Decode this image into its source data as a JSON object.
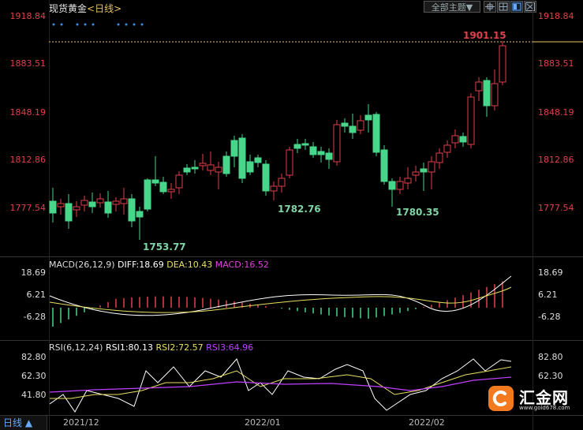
{
  "header": {
    "instrument": "现货黄金",
    "period": "<日线>",
    "theme_select": "全部主题▼",
    "toolbar_icons": [
      "crosshair-icon",
      "grid-icon",
      "layout-icon",
      "close-icon"
    ]
  },
  "price_axis": {
    "labels": [
      "1918.84",
      "1883.51",
      "1848.19",
      "1812.86",
      "1777.54"
    ]
  },
  "annotations": {
    "low1": "1753.77",
    "low2": "1782.76",
    "low3": "1780.35",
    "high": "1901.15"
  },
  "macd": {
    "title": "MACD(26,12,9)",
    "diff_label": "DIFF:18.69",
    "dea_label": "DEA:10.43",
    "macd_label": "MACD:16.52",
    "axis": [
      "18.69",
      "6.21",
      "-6.28"
    ],
    "colors": {
      "diff": "#ffffff",
      "dea": "#e8e060",
      "macd": "#e040e0"
    }
  },
  "rsi": {
    "title": "RSI(6,12,24)",
    "rsi1_label": "RSI1:80.13",
    "rsi2_label": "RSI2:72.57",
    "rsi3_label": "RSI3:64.96",
    "axis": [
      "82.80",
      "62.30",
      "41.80"
    ],
    "colors": {
      "rsi1": "#ffffff",
      "rsi2": "#e8e060",
      "rsi3": "#c040ff"
    }
  },
  "xaxis": {
    "period_button": "日线 ▲",
    "labels": [
      "2021/12",
      "2022/01",
      "2022/02"
    ]
  },
  "logo": {
    "name": "汇金网",
    "url": "www.gold678.com"
  },
  "colors": {
    "up": "#e0404a",
    "down": "#48d68a",
    "background": "#000000"
  }
}
